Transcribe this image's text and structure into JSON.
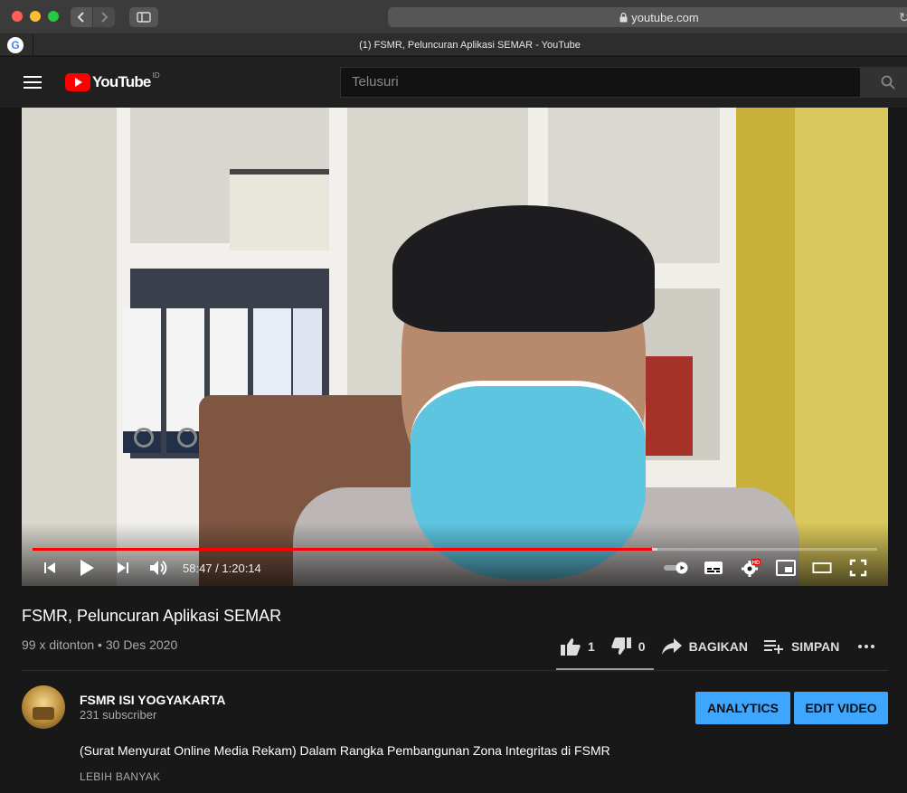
{
  "browser": {
    "url": "youtube.com",
    "tab_title": "(1) FSMR, Peluncuran Aplikasi SEMAR - YouTube",
    "favicon_letter": "G"
  },
  "header": {
    "logo_text": "YouTube",
    "region": "ID",
    "search_placeholder": "Telusuri"
  },
  "player": {
    "current_time": "58:47",
    "separator": " / ",
    "duration": "1:20:14",
    "progress_played": 0.733,
    "progress_buffered": 0.74,
    "hd_badge": "HD"
  },
  "video": {
    "title": "FSMR, Peluncuran Aplikasi SEMAR",
    "views": "99 x ditonton",
    "dot": " • ",
    "date": "30 Des 2020",
    "likes": "1",
    "dislikes": "0",
    "share_label": "BAGIKAN",
    "save_label": "SIMPAN"
  },
  "channel": {
    "name": "FSMR ISI YOGYAKARTA",
    "subscribers": "231 subscriber",
    "analytics_label": "ANALYTICS",
    "edit_label": "EDIT VIDEO",
    "description": "(Surat Menyurat Online Media Rekam) Dalam Rangka Pembangunan Zona Integritas di FSMR",
    "show_more": "LEBIH BANYAK"
  },
  "colors": {
    "accent_red": "#ff0000",
    "button_blue": "#3ea6ff",
    "background": "#181818"
  }
}
